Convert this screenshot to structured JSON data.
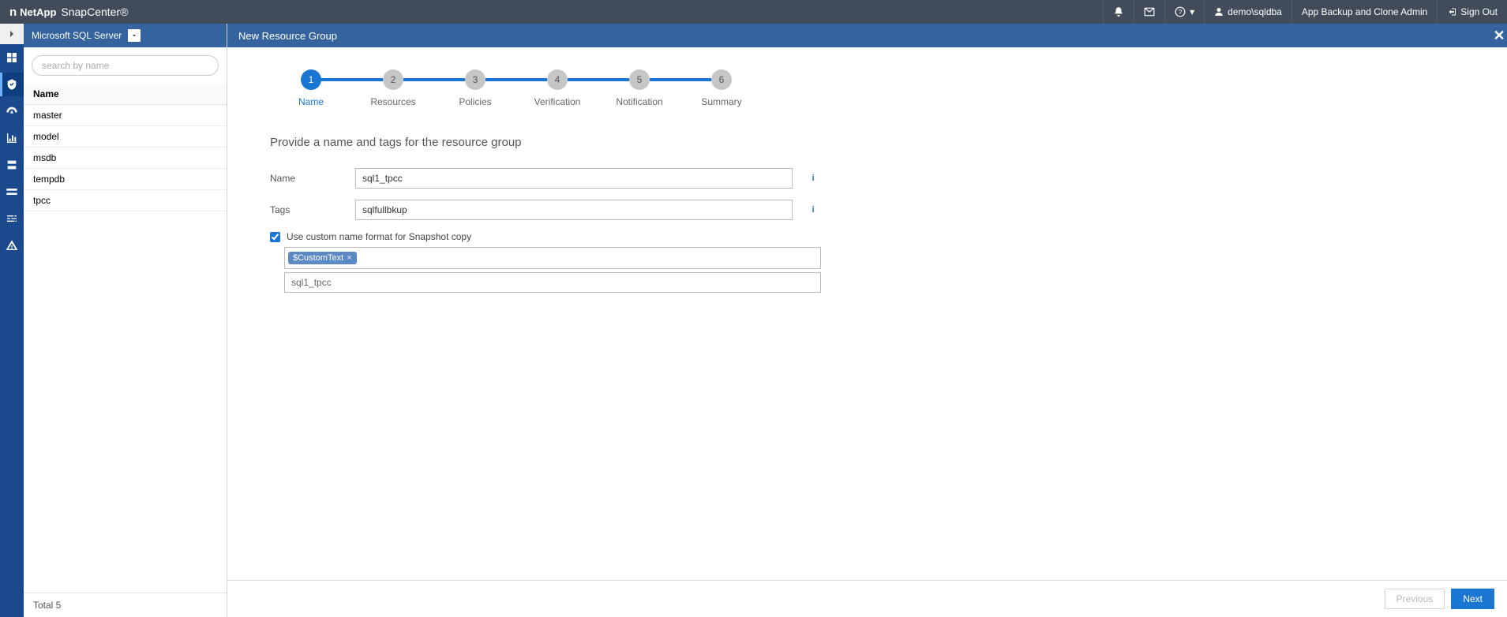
{
  "brand": {
    "company": "NetApp",
    "product": "SnapCenter®"
  },
  "header": {
    "user": "demo\\sqldba",
    "role": "App Backup and Clone Admin",
    "signout": "Sign Out"
  },
  "sidebar_select": {
    "value": "Microsoft SQL Server"
  },
  "search": {
    "placeholder": "search by name"
  },
  "res_table": {
    "header": "Name",
    "rows": [
      "master",
      "model",
      "msdb",
      "tempdb",
      "tpcc"
    ]
  },
  "res_footer": "Total 5",
  "content": {
    "title": "New Resource Group"
  },
  "steps": [
    {
      "n": "1",
      "label": "Name"
    },
    {
      "n": "2",
      "label": "Resources"
    },
    {
      "n": "3",
      "label": "Policies"
    },
    {
      "n": "4",
      "label": "Verification"
    },
    {
      "n": "5",
      "label": "Notification"
    },
    {
      "n": "6",
      "label": "Summary"
    }
  ],
  "form": {
    "heading": "Provide a name and tags for the resource group",
    "name_label": "Name",
    "name_value": "sql1_tpcc",
    "tags_label": "Tags",
    "tags_value": "sqlfullbkup",
    "chk_label": "Use custom name format for Snapshot copy",
    "chk_checked": true,
    "pill": "$CustomText",
    "custom_value": "sql1_tpcc"
  },
  "footer": {
    "prev": "Previous",
    "next": "Next"
  }
}
